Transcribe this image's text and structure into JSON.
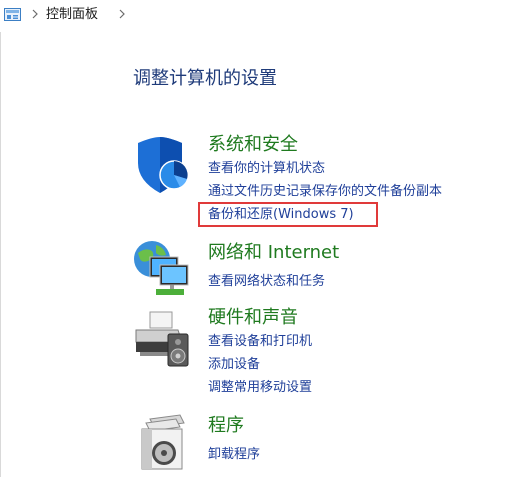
{
  "breadcrumb": {
    "current": "控制面板",
    "icon": "control-panel-icon"
  },
  "main": {
    "title": "调整计算机的设置"
  },
  "categories": [
    {
      "icon": "shield-icon",
      "title": "系统和安全",
      "links": [
        "查看你的计算机状态",
        "通过文件历史记录保存你的文件备份副本",
        "备份和还原(Windows 7)"
      ],
      "highlighted_link": "备份和还原(Windows 7)"
    },
    {
      "icon": "network-globe-icon",
      "title": "网络和 Internet",
      "links": [
        "查看网络状态和任务"
      ]
    },
    {
      "icon": "printer-speaker-icon",
      "title": "硬件和声音",
      "links": [
        "查看设备和打印机",
        "添加设备",
        "调整常用移动设置"
      ]
    },
    {
      "icon": "programs-disc-icon",
      "title": "程序",
      "links": [
        "卸载程序"
      ]
    }
  ],
  "colors": {
    "category_title": "#1f7a1f",
    "link": "#1f3f99",
    "main_title": "#1f3b7a",
    "highlight_border": "#e03a3a"
  }
}
